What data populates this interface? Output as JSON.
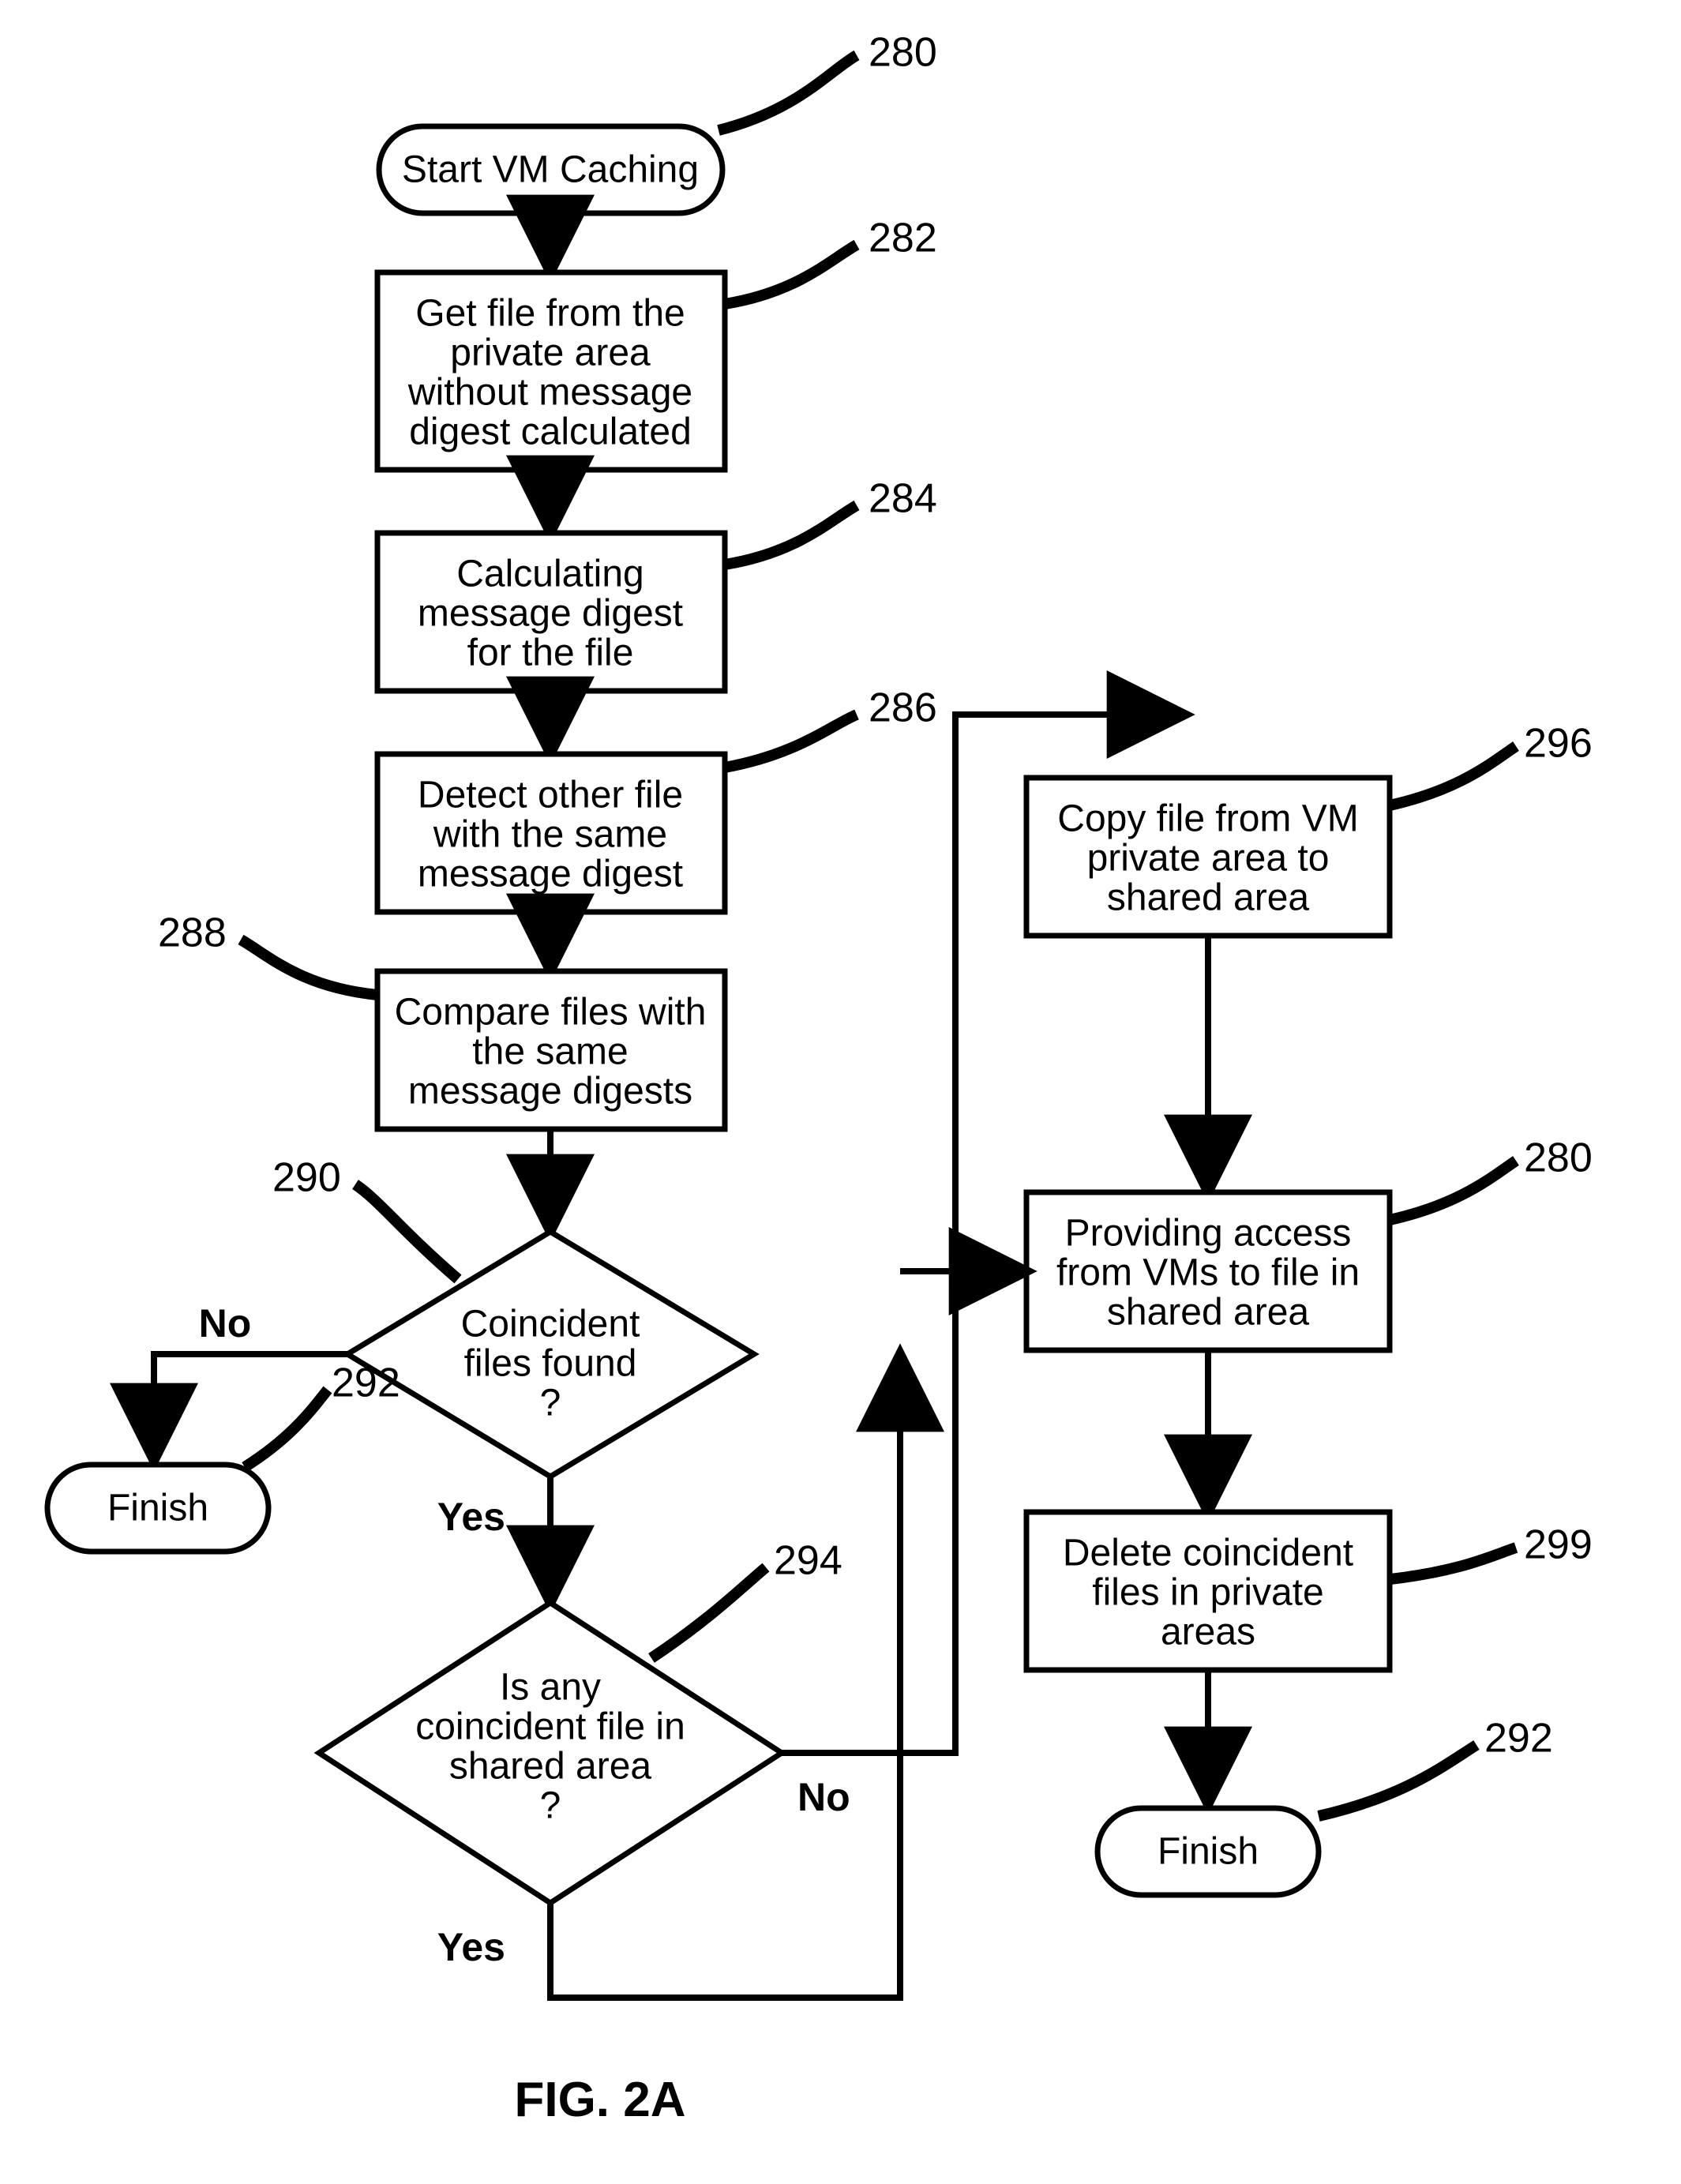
{
  "figure": "FIG. 2A",
  "nodes": {
    "n280a": {
      "ref": "280",
      "text": [
        "Start VM Caching"
      ]
    },
    "n282": {
      "ref": "282",
      "text": [
        "Get file from the",
        "private area",
        "without message",
        "digest calculated"
      ]
    },
    "n284": {
      "ref": "284",
      "text": [
        "Calculating",
        "message digest",
        "for the file"
      ]
    },
    "n286": {
      "ref": "286",
      "text": [
        "Detect other file",
        "with the same",
        "message digest"
      ]
    },
    "n288": {
      "ref": "288",
      "text": [
        "Compare files with",
        "the same",
        "message digests"
      ]
    },
    "n290": {
      "ref": "290",
      "text": [
        "Coincident",
        "files found",
        "?"
      ]
    },
    "n292a": {
      "ref": "292",
      "text": [
        "Finish"
      ]
    },
    "n294": {
      "ref": "294",
      "text": [
        "Is any",
        "coincident file in",
        "shared area",
        "?"
      ]
    },
    "n296": {
      "ref": "296",
      "text": [
        "Copy file from VM",
        "private area to",
        "shared area"
      ]
    },
    "n280b": {
      "ref": "280",
      "text": [
        "Providing access",
        "from VMs to file in",
        "shared area"
      ]
    },
    "n299": {
      "ref": "299",
      "text": [
        "Delete coincident",
        "files in private",
        "areas"
      ]
    },
    "n292b": {
      "ref": "292",
      "text": [
        "Finish"
      ]
    }
  },
  "branches": {
    "no": "No",
    "yes": "Yes"
  }
}
